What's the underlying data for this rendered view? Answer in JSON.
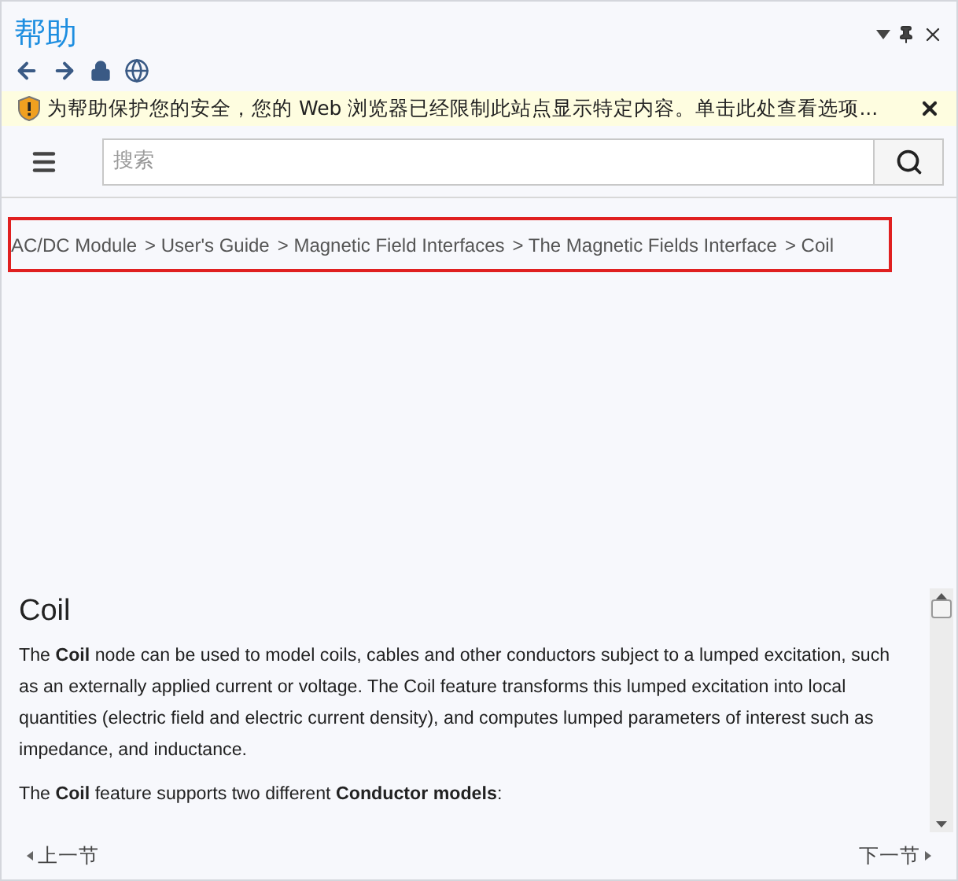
{
  "window": {
    "title": "帮助"
  },
  "security_bar": {
    "message": "为帮助保护您的安全，您的 Web 浏览器已经限制此站点显示特定内容。单击此处查看选项..."
  },
  "search": {
    "placeholder": "搜索"
  },
  "breadcrumb": [
    "AC/DC Module",
    "> User's Guide",
    "> Magnetic Field Interfaces",
    "> The Magnetic Fields Interface",
    "> Coil"
  ],
  "article": {
    "heading": "Coil",
    "paragraphs": [
      "The **Coil** node can be used to model coils, cables and other conductors subject to a lumped excitation, such as an externally applied current or voltage. The Coil feature transforms this lumped excitation into local quantities (electric field and electric current density), and computes lumped parameters of interest such as impedance, and inductance.",
      "The **Coil** feature supports two different **Conductor models**:"
    ]
  },
  "footer": {
    "previous": "上一节",
    "next": "下一节"
  }
}
